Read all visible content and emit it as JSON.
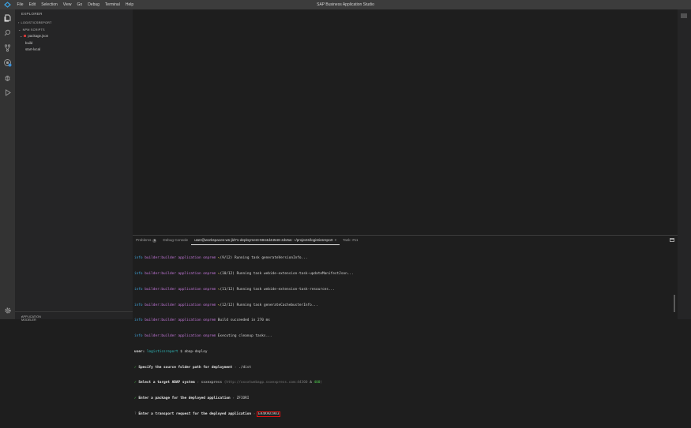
{
  "menubar": {
    "items": [
      "File",
      "Edit",
      "Selection",
      "View",
      "Go",
      "Debug",
      "Terminal",
      "Help"
    ],
    "title": "SAP Business Application Studio"
  },
  "activity_bar": {
    "icons": [
      "explorer-icon",
      "search-icon",
      "source-control-icon",
      "cloud-icon",
      "debug-icon",
      "run-icon",
      "settings-icon"
    ]
  },
  "sidebar": {
    "header": "EXPLORER",
    "project_section": "LOGISTICSREPORT",
    "npm_section": "NPM SCRIPTS",
    "package": "package.json",
    "scripts": [
      "build",
      "start-local"
    ],
    "bottom_section": "APPLICATION MODELER"
  },
  "panel": {
    "tabs": {
      "problems": "Problems",
      "problems_count": "0",
      "debug_console": "Debug Console",
      "terminal": "user@workspaces-ws-jld71-deployment-5944d44546-zdv5w: ~/projects/logisticsreport",
      "close": "×",
      "task": "Task: #11"
    },
    "terminal": {
      "info_prefix": "info",
      "builder": "builder:builder application onprem",
      "lines": [
        {
          "step": "(9/12)",
          "text": "Running task generateVersionInfo..."
        },
        {
          "step": "(10/12)",
          "text": "Running task webide-extension-task-updateManifestJson..."
        },
        {
          "step": "(11/12)",
          "text": "Running task webide-extension-task-resources..."
        },
        {
          "step": "(12/12)",
          "text": "Running task generateCachebusterInfo..."
        },
        {
          "step": "",
          "text": "Build succeeded in 270 ms"
        },
        {
          "step": "",
          "text": "Executing cleanup tasks..."
        }
      ],
      "prompt_user": "user:",
      "prompt_path": "logisticsreport",
      "prompt_cmd": "$ abap-deploy",
      "q1_label": "Specify the source folder path for deployment",
      "q1_value": "./dist",
      "q2_label": "Select a target ABAP system",
      "q2_value": "sxxexpress",
      "q2_url": "(http://xxxxtwebapp.sxxexpress.com:44300",
      "q2_client": "400",
      "q3_label": "Enter a package for the deployed application",
      "q3_value": "ZFIORI",
      "q4_label": "Enter a transport request for the deployed application",
      "q4_value": "ER4K901983"
    }
  }
}
